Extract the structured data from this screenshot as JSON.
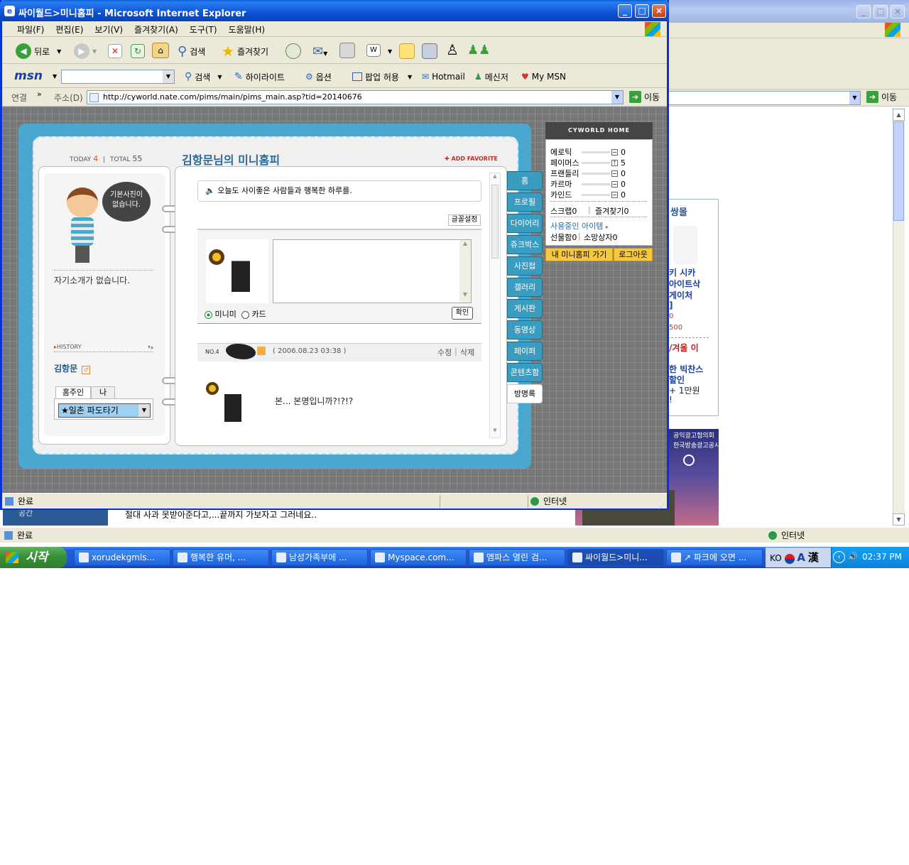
{
  "bg_window": {
    "side_title": "쌍몰",
    "product_lines": [
      "키 시카",
      "아이트삭",
      "게이처",
      "]"
    ],
    "price1": "0",
    "price2": "500",
    "promo_head": "/겨울 이",
    "promo_lines": [
      "한 빅찬스",
      "할인",
      "+ 1만원",
      "!"
    ],
    "ad_top": "공익광고협의회",
    "ad_sub": "한국방송광고공사",
    "bottom_text": "절대 사과 못받아준다고,...끝까지 가보자고 그러네요..",
    "side_link": "공간",
    "go_label": "이동",
    "status_left": "완료",
    "status_zone": "인터넷"
  },
  "window": {
    "title": "싸이월드>미니홈피 - Microsoft Internet Explorer",
    "menu": [
      "파일(F)",
      "편집(E)",
      "보기(V)",
      "즐겨찾기(A)",
      "도구(T)",
      "도움말(H)"
    ],
    "toolbar": {
      "back": "뒤로",
      "search": "검색",
      "favorites": "즐겨찾기"
    },
    "msn": {
      "logo": "msn",
      "search": "검색",
      "highlight": "하이라이트",
      "options": "옵션",
      "popup": "팝업 허용",
      "hotmail": "Hotmail",
      "messenger": "메신저",
      "mymsn": "My MSN"
    },
    "address": {
      "links": "연결",
      "label": "주소(D)",
      "url": "http://cyworld.nate.com/pims/main/pims_main.asp?tid=20140676",
      "go": "이동"
    },
    "status": {
      "text": "완료",
      "zone": "인터넷"
    }
  },
  "minihompy": {
    "today_label": "TODAY",
    "today": "4",
    "total_label": "TOTAL",
    "total": "55",
    "title": "김항문님의 미니홈피",
    "add_favorite": "ADD FAVORITE",
    "profile_bubble": "기본사진이 없습니다.",
    "intro": "자기소개가 없습니다.",
    "history": "HISTORY",
    "name": "김항문",
    "owner_tab": "홈주인",
    "me_tab": "나",
    "select_value": "★일촌 파도타기",
    "notice": "오늘도 사이좋은 사람들과 행복한 하루를.",
    "font_setting": "글꼴설정",
    "radio_minimi": "미니미",
    "radio_card": "카드",
    "confirm": "확인",
    "entry_no": "NO.4",
    "entry_date": "( 2006.08.23 03:38 )",
    "edit": "수정",
    "delete": "삭제",
    "entry_text": "본... 본명입니까?!?!?",
    "tabs": [
      "홈",
      "프로필",
      "다이어리",
      "쥬크박스",
      "사진첩",
      "갤러리",
      "게시판",
      "동영상",
      "페이퍼",
      "콘텐츠함",
      "방명록"
    ]
  },
  "cyworld_home": {
    "header": "CYWORLD HOME",
    "stats": [
      {
        "label": "에로틱",
        "value": "0",
        "mark": "−"
      },
      {
        "label": "페이머스",
        "value": "5",
        "mark": "↑"
      },
      {
        "label": "프랜들리",
        "value": "0",
        "mark": "−"
      },
      {
        "label": "카르마",
        "value": "0",
        "mark": "−"
      },
      {
        "label": "카인드",
        "value": "0",
        "mark": "−"
      }
    ],
    "scrap": "스크랩0",
    "favorites": "즐겨찾기0",
    "items_in_use": "사용중인 아이템",
    "gifts": "선물함0",
    "wishes": "소망상자0",
    "go_my": "내 미니홈피 가기",
    "logout": "로그아웃"
  },
  "taskbar": {
    "start": "시작",
    "items": [
      "xorudekgmls...",
      "행복한 유머, ...",
      "남성가족부에 ...",
      "Myspace.com...",
      "엠파스 열린 검...",
      "싸이월드>미니...",
      "↗ 파크에 오면 ..."
    ],
    "lang": "KO",
    "ime1": "A",
    "ime2": "漢",
    "clock": "02:37 PM"
  }
}
